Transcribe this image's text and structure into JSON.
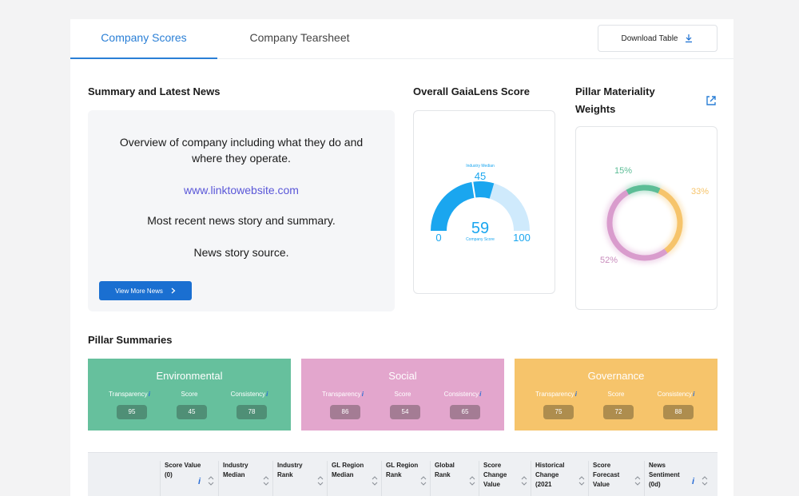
{
  "tabs": [
    {
      "label": "Company Scores",
      "active": true
    },
    {
      "label": "Company Tearsheet",
      "active": false
    }
  ],
  "download_label": "Download Table",
  "summary": {
    "title": "Summary and Latest News",
    "overview": "Overview of company including what they do and where they operate.",
    "link": "www.linktowebsite.com",
    "news": "Most recent news story and summary.",
    "source": "News story source.",
    "button_label": "View More News"
  },
  "score": {
    "title": "Overall GaiaLens Score",
    "median_label": "Industry Median",
    "median_value": "45",
    "company_value": "59",
    "company_label": "Company Score",
    "min": "0",
    "max": "100",
    "value": 59,
    "median": 45,
    "colors": {
      "fill": "#1aa6ef",
      "track": "#cfeafc"
    }
  },
  "weights": {
    "title": "Pillar Materiality Weights",
    "slices": [
      {
        "label": "15%",
        "value": 15,
        "color": "#5cbd96"
      },
      {
        "label": "33%",
        "value": 33,
        "color": "#f6c46b"
      },
      {
        "label": "52%",
        "value": 52,
        "color": "#d99ccd"
      }
    ]
  },
  "pillars_title": "Pillar Summaries",
  "pillars": [
    {
      "name": "Environmental",
      "transparency": "95",
      "score": "45",
      "consistency": "78",
      "color": "#66c09d"
    },
    {
      "name": "Social",
      "transparency": "86",
      "score": "54",
      "consistency": "65",
      "color": "#e3a6cd"
    },
    {
      "name": "Governance",
      "transparency": "75",
      "score": "72",
      "consistency": "88",
      "color": "#f6c46b"
    }
  ],
  "metric_labels": {
    "transparency": "Transparency",
    "score": "Score",
    "consistency": "Consistency"
  },
  "table_headers": [
    {
      "label": "Score Value (0)",
      "info": true
    },
    {
      "label": "Industry Median",
      "info": false
    },
    {
      "label": "Industry Rank",
      "info": false
    },
    {
      "label": "GL Region Median",
      "info": false
    },
    {
      "label": "GL Region Rank",
      "info": false
    },
    {
      "label": "Global Rank",
      "info": false
    },
    {
      "label": "Score Change Value",
      "info": false
    },
    {
      "label": "Historical Change (2021",
      "info": false
    },
    {
      "label": "Score Forecast Value",
      "info": false
    },
    {
      "label": "News Sentiment (0d)",
      "info": true
    }
  ]
}
